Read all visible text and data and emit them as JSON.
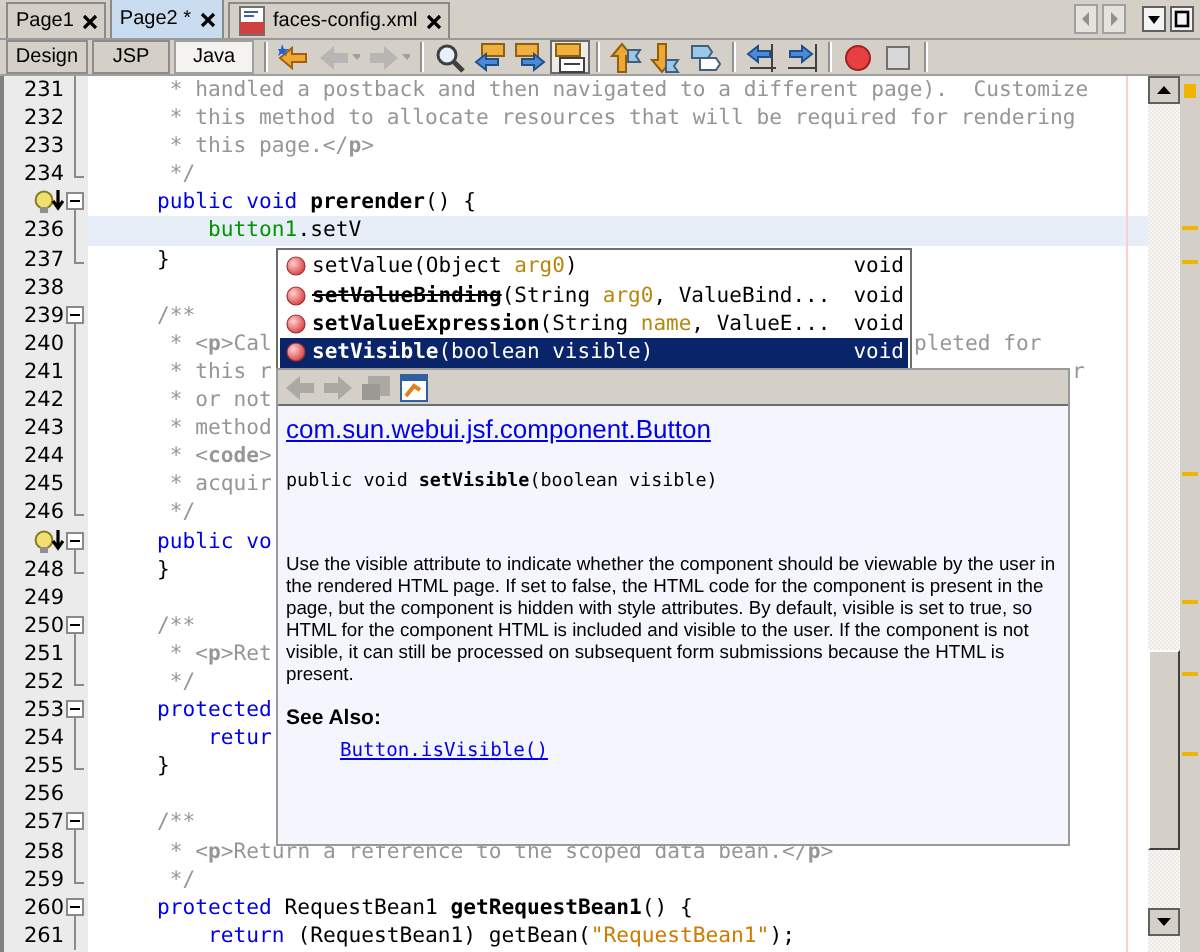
{
  "file_tabs": [
    {
      "label": "Page1",
      "selected": false,
      "kind": "page"
    },
    {
      "label": "Page2 *",
      "selected": true,
      "kind": "page"
    },
    {
      "label": "faces-config.xml",
      "selected": false,
      "kind": "xml"
    }
  ],
  "toolbar": {
    "view_tabs": [
      {
        "label": "Design",
        "selected": false
      },
      {
        "label": "JSP",
        "selected": false
      },
      {
        "label": "Java",
        "selected": true
      }
    ],
    "button_groups": [
      [
        {
          "kind": "last-edit",
          "disabled": false,
          "pressed": false
        },
        {
          "kind": "back",
          "disabled": true,
          "pressed": false
        },
        {
          "kind": "forward",
          "disabled": true,
          "pressed": false
        }
      ],
      [
        {
          "kind": "find-selection",
          "disabled": false,
          "pressed": false
        },
        {
          "kind": "previous-match",
          "disabled": false,
          "pressed": false
        },
        {
          "kind": "next-match",
          "disabled": false,
          "pressed": false
        },
        {
          "kind": "highlight",
          "disabled": false,
          "pressed": true
        }
      ],
      [
        {
          "kind": "previous-bookmark",
          "disabled": false,
          "pressed": false
        },
        {
          "kind": "next-bookmark",
          "disabled": false,
          "pressed": false
        },
        {
          "kind": "toggle-bookmark",
          "disabled": false,
          "pressed": false
        }
      ],
      [
        {
          "kind": "shift-left",
          "disabled": false,
          "pressed": false
        },
        {
          "kind": "shift-right",
          "disabled": false,
          "pressed": false
        }
      ],
      [
        {
          "kind": "record-macro",
          "disabled": false,
          "pressed": false
        },
        {
          "kind": "stop-macro",
          "disabled": false,
          "pressed": false
        }
      ]
    ]
  },
  "editor": {
    "lines": [
      {
        "number": "231",
        "kind": "line",
        "current": false,
        "parts": [
          {
            "text": "     * handled a postback and then navigated to a different page).  Customize",
            "kind": "comment"
          }
        ]
      },
      {
        "number": "232",
        "kind": "line",
        "current": false,
        "parts": [
          {
            "text": "     * this method to allocate resources that will be required for rendering",
            "kind": "comment"
          }
        ]
      },
      {
        "number": "233",
        "kind": "line",
        "current": false,
        "parts": [
          {
            "text": "     * this page.</**p**>",
            "kind": "comment"
          }
        ]
      },
      {
        "number": "234",
        "kind": "fold-end",
        "current": false,
        "parts": [
          {
            "text": "     */",
            "kind": "comment"
          }
        ]
      },
      {
        "marker": true,
        "kind": "fold-start",
        "current": false,
        "parts": [
          {
            "text": "    public void ",
            "kind": "keyword"
          },
          {
            "text": "prerender",
            "kind": "bold"
          },
          {
            "text": "() {",
            "kind": "plain"
          }
        ]
      },
      {
        "number": "236",
        "kind": "line",
        "current": true,
        "parts": [
          {
            "text": "        button1",
            "kind": "field"
          },
          {
            "text": ".setV",
            "kind": "plain"
          }
        ]
      },
      {
        "number": "237",
        "kind": "fold-end",
        "current": false,
        "parts": [
          {
            "text": "    }",
            "kind": "plain"
          }
        ]
      },
      {
        "number": "238",
        "kind": "line",
        "current": false
      },
      {
        "number": "239",
        "kind": "fold-start",
        "current": false,
        "parts": [
          {
            "text": "    /**",
            "kind": "comment"
          }
        ]
      },
      {
        "number": "240",
        "kind": "line",
        "current": false,
        "parts": [
          {
            "text": "     * <**p**>Cal",
            "kind": "comment"
          }
        ],
        "tail": "pleted for"
      },
      {
        "number": "241",
        "kind": "line",
        "current": false,
        "parts": [
          {
            "text": "     * this r",
            "kind": "comment"
          }
        ],
        "tail": "r"
      },
      {
        "number": "242",
        "kind": "line",
        "current": false,
        "parts": [
          {
            "text": "     * or not",
            "kind": "comment"
          }
        ]
      },
      {
        "number": "243",
        "kind": "line",
        "current": false,
        "parts": [
          {
            "text": "     * method",
            "kind": "comment"
          }
        ]
      },
      {
        "number": "244",
        "kind": "line",
        "current": false,
        "parts": [
          {
            "text": "     * <**code**>",
            "kind": "comment"
          }
        ]
      },
      {
        "number": "245",
        "kind": "line",
        "current": false,
        "parts": [
          {
            "text": "     * acquir",
            "kind": "comment"
          }
        ]
      },
      {
        "number": "246",
        "kind": "fold-end",
        "current": false,
        "parts": [
          {
            "text": "     */",
            "kind": "comment"
          }
        ]
      },
      {
        "marker": true,
        "kind": "fold-start",
        "current": false,
        "parts": [
          {
            "text": "    public vo",
            "kind": "keyword"
          }
        ]
      },
      {
        "number": "248",
        "kind": "fold-end",
        "current": false,
        "parts": [
          {
            "text": "    }",
            "kind": "plain"
          }
        ]
      },
      {
        "number": "249",
        "kind": "line",
        "current": false
      },
      {
        "number": "250",
        "kind": "fold-start",
        "current": false,
        "parts": [
          {
            "text": "    /**",
            "kind": "comment"
          }
        ]
      },
      {
        "number": "251",
        "kind": "line",
        "current": false,
        "parts": [
          {
            "text": "     * <**p**>Ret",
            "kind": "comment"
          }
        ]
      },
      {
        "number": "252",
        "kind": "fold-end",
        "current": false,
        "parts": [
          {
            "text": "     */",
            "kind": "comment"
          }
        ]
      },
      {
        "number": "253",
        "kind": "fold-start",
        "current": false,
        "parts": [
          {
            "text": "    protected",
            "kind": "keyword"
          }
        ]
      },
      {
        "number": "254",
        "kind": "line",
        "current": false,
        "parts": [
          {
            "text": "        retur",
            "kind": "keyword"
          }
        ]
      },
      {
        "number": "255",
        "kind": "fold-end",
        "current": false,
        "parts": [
          {
            "text": "    }",
            "kind": "plain"
          }
        ]
      },
      {
        "number": "256",
        "kind": "line",
        "current": false
      },
      {
        "number": "257",
        "kind": "fold-start",
        "current": false,
        "parts": [
          {
            "text": "    /**",
            "kind": "comment"
          }
        ]
      },
      {
        "number": "258",
        "kind": "line",
        "current": false,
        "parts": [
          {
            "text": "     * <**p**>Return a reference to the scoped data bean.</**p**>",
            "kind": "comment"
          }
        ]
      },
      {
        "number": "259",
        "kind": "fold-end",
        "current": false,
        "parts": [
          {
            "text": "     */",
            "kind": "comment"
          }
        ]
      },
      {
        "number": "260",
        "kind": "fold-start",
        "current": false,
        "parts": [
          {
            "text": "    protected ",
            "kind": "keyword"
          },
          {
            "text": "RequestBean1 ",
            "kind": "plain"
          },
          {
            "text": "getRequestBean1",
            "kind": "bold"
          },
          {
            "text": "() {",
            "kind": "plain"
          }
        ]
      },
      {
        "number": "261",
        "kind": "line",
        "current": false,
        "parts": [
          {
            "text": "        return ",
            "kind": "keyword"
          },
          {
            "text": "(RequestBean1) getBean(",
            "kind": "plain"
          },
          {
            "text": "\"RequestBean1\"",
            "kind": "string"
          },
          {
            "text": ");",
            "kind": "plain"
          }
        ]
      }
    ]
  },
  "completion": {
    "items": [
      {
        "name": "setValue",
        "deprecated": false,
        "bold": false,
        "selected": false,
        "params": [
          {
            "text": "(Object ",
            "kind": "type"
          },
          {
            "text": "arg0",
            "kind": "arg"
          },
          {
            "text": ")",
            "kind": "type"
          }
        ],
        "returns": "void"
      },
      {
        "name": "setValueBinding",
        "deprecated": true,
        "bold": true,
        "selected": false,
        "params": [
          {
            "text": "(String ",
            "kind": "type"
          },
          {
            "text": "arg0",
            "kind": "arg"
          },
          {
            "text": ", ValueBind...",
            "kind": "type"
          }
        ],
        "returns": "void"
      },
      {
        "name": "setValueExpression",
        "deprecated": false,
        "bold": true,
        "selected": false,
        "params": [
          {
            "text": "(String ",
            "kind": "type"
          },
          {
            "text": "name",
            "kind": "arg"
          },
          {
            "text": ", ValueE...",
            "kind": "type"
          }
        ],
        "returns": "void"
      },
      {
        "name": "setVisible",
        "deprecated": false,
        "bold": true,
        "selected": true,
        "params": [
          {
            "text": "(boolean visible)",
            "kind": "type"
          }
        ],
        "returns": "void"
      }
    ]
  },
  "javadoc": {
    "toolbar": [
      {
        "kind": "back",
        "disabled": true
      },
      {
        "kind": "forward",
        "disabled": true
      },
      {
        "kind": "source",
        "disabled": true
      },
      {
        "kind": "browser",
        "disabled": false
      }
    ],
    "class_link": "com.sun.webui.jsf.component.Button",
    "signature": "public void **setVisible**(boolean visible)",
    "description": "Use the visible attribute to indicate whether the component should be viewable by the user in the rendered HTML page. If set to false, the HTML code for the component is present in the page, but the component is hidden with style attributes. By default, visible is set to true, so HTML for the component HTML is included and visible to the user. If the component is not visible, it can still be processed on subsequent form submissions because the HTML is present.",
    "see_also_heading": "See Also:",
    "see_also_links": [
      "Button.isVisible()"
    ]
  }
}
